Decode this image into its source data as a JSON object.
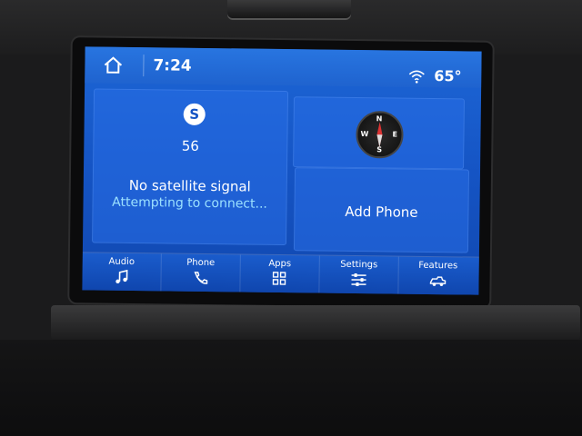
{
  "status": {
    "time": "7:24",
    "temperature": "65°"
  },
  "radio": {
    "logo_letter": "S",
    "channel": "56",
    "message": "No satellite signal",
    "submessage": "Attempting to connect..."
  },
  "compass": {
    "letters": [
      "N",
      "E",
      "S",
      "W"
    ]
  },
  "phone_tile": {
    "label": "Add Phone"
  },
  "nav": {
    "items": [
      {
        "label": "Audio",
        "icon": "music-note-icon"
      },
      {
        "label": "Phone",
        "icon": "phone-icon"
      },
      {
        "label": "Apps",
        "icon": "apps-grid-icon"
      },
      {
        "label": "Settings",
        "icon": "sliders-icon"
      },
      {
        "label": "Features",
        "icon": "truck-icon"
      }
    ]
  },
  "colors": {
    "screen_blue": "#1554c4",
    "accent_cyan": "#9be0ff",
    "text": "#ffffff"
  }
}
